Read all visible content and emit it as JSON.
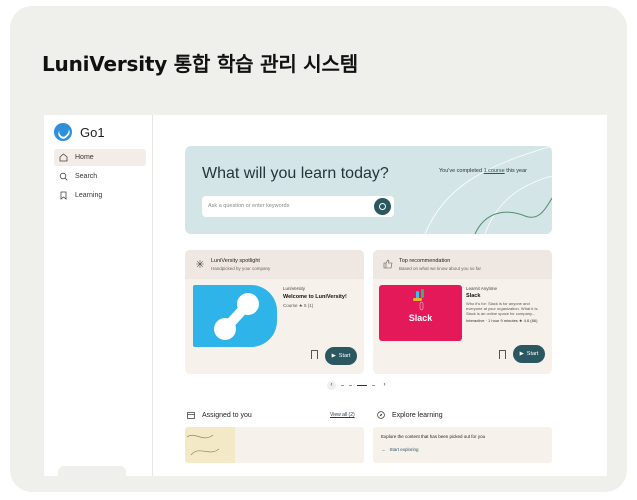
{
  "card": {
    "title": "LuniVersity 통합 학습 관리 시스템"
  },
  "sidebar": {
    "logo_text": "Go1",
    "items": [
      {
        "label": "Home",
        "icon": "home-icon",
        "active": true
      },
      {
        "label": "Search",
        "icon": "search-icon",
        "active": false
      },
      {
        "label": "Learning",
        "icon": "bookmark-icon",
        "active": false
      }
    ]
  },
  "hero": {
    "title": "What will you learn today?",
    "search_placeholder": "Ask a question or enter keywords",
    "progress_prefix": "You've completed",
    "progress_link": "1 course",
    "progress_suffix": "this year"
  },
  "spotlight": {
    "title": "LuniVersity spotlight",
    "subtitle": "Handpicked by your company",
    "provider": "LuniVersity",
    "name": "Welcome to LuniVersity!",
    "meta": "Course  ★ 5 (1)",
    "start_label": "Start"
  },
  "recommendation": {
    "title": "Top recommendation",
    "subtitle": "Based on what we know about you so far",
    "thumb_text": "Slack",
    "provider": "Learnit Anytime",
    "name": "Slack",
    "description": "Who it's for: Slack is for anyone and everyone at your organization. What it is: Slack is an online space for company...",
    "info": "Interactive · 1 hour 9 minutes  ★ 4.6 (86)",
    "start_label": "Start"
  },
  "assigned": {
    "title": "Assigned to you",
    "view_all": "View all (2)"
  },
  "explore": {
    "title": "Explore learning",
    "text": "Explore the content that has been picked out for you",
    "link": "Start exploring"
  },
  "colors": {
    "accent": "#2a5760",
    "hero_bg": "#d3e5e6",
    "panel_bg": "#f7f1ec",
    "slack_bg": "#e4195a",
    "spot_bg": "#2fb4e9"
  }
}
